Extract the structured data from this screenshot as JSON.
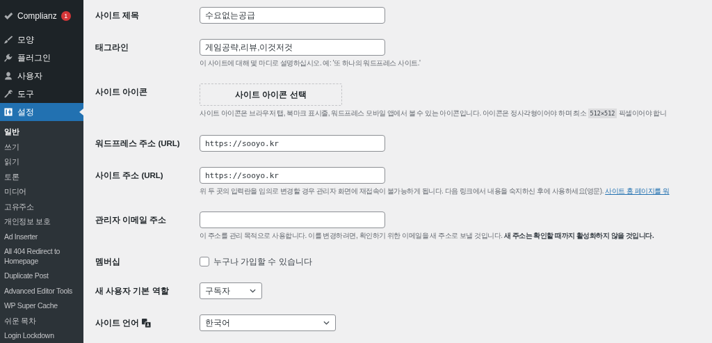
{
  "sidebar": {
    "menu": [
      {
        "label": "Complianz",
        "badge": "1",
        "selected": false
      },
      {
        "label": "모양",
        "selected": false
      },
      {
        "label": "플러그인",
        "selected": false
      },
      {
        "label": "사용자",
        "selected": false
      },
      {
        "label": "도구",
        "selected": false
      },
      {
        "label": "설정",
        "selected": true
      }
    ],
    "submenu": [
      {
        "label": "일반",
        "selected": true
      },
      {
        "label": "쓰기",
        "selected": false
      },
      {
        "label": "읽기",
        "selected": false
      },
      {
        "label": "토론",
        "selected": false
      },
      {
        "label": "미디어",
        "selected": false
      },
      {
        "label": "고유주소",
        "selected": false
      },
      {
        "label": "개인정보 보호",
        "selected": false
      },
      {
        "label": "Ad Inserter",
        "selected": false
      },
      {
        "label": "All 404 Redirect to Homepage",
        "selected": false
      },
      {
        "label": "Duplicate Post",
        "selected": false
      },
      {
        "label": "Advanced Editor Tools",
        "selected": false
      },
      {
        "label": "WP Super Cache",
        "selected": false
      },
      {
        "label": "쉬운 목차",
        "selected": false
      },
      {
        "label": "Login Lockdown",
        "selected": false
      }
    ]
  },
  "settings": [
    {
      "kind": "text",
      "label": "사이트 제목",
      "value": "수요없는공급"
    },
    {
      "kind": "text",
      "label": "태그라인",
      "value": "게임공략,리뷰,이것저것",
      "description": [
        {
          "kind": "text",
          "text": "이 사이트에 대해 몇 마디로 설명하십시오. 예: '또 하나의 워드프레스 사이트.'"
        }
      ]
    },
    {
      "kind": "button",
      "label": "사이트 아이콘",
      "button": "사이트 아이콘 선택",
      "description": [
        {
          "kind": "text",
          "text": "사이트 아이콘은 브라우저 탭, 북마크 표시줄, 워드프레스 모바일 앱에서 볼 수 있는 아이콘입니다. 아이콘은 정사각형이어야 하며 최소 "
        },
        {
          "kind": "code",
          "text": "512×512"
        },
        {
          "kind": "text",
          "text": " 픽셀이어야 합니"
        }
      ]
    },
    {
      "kind": "url",
      "label": "워드프레스 주소 (URL)",
      "value": "https://sooyo.kr"
    },
    {
      "kind": "url",
      "label": "사이트 주소 (URL)",
      "value": "https://sooyo.kr",
      "description": [
        {
          "kind": "text",
          "text": "위 두 곳의 입력란을 임의로 변경할 경우 관리자 화면에 재접속이 불가능하게 됩니다. 다음 링크에서 내용을 숙지하신 후에 사용하세요(영문). "
        },
        {
          "kind": "link",
          "text": "사이트 홈 페이지를 워"
        }
      ]
    },
    {
      "kind": "text",
      "label": "관리자 이메일 주소",
      "description": [
        {
          "kind": "text",
          "text": "이 주소를 관리 목적으로 사용합니다. 이를 변경하려면, 확인하기 위한 이메일을 새 주소로 보낼 것입니다. **새 주소는 확인할 때까지 활성화하지 않을 것입니다.**"
        }
      ]
    },
    {
      "kind": "checkbox",
      "label": "멤버십",
      "option": "누구나 가입할 수 있습니다",
      "checked": false
    },
    {
      "kind": "select",
      "label": "새 사용자 기본 역할",
      "value": "구독자",
      "wide": false
    },
    {
      "kind": "select",
      "label": "사이트 언어",
      "value": "한국어",
      "wide": true,
      "translate_icon": true
    }
  ]
}
